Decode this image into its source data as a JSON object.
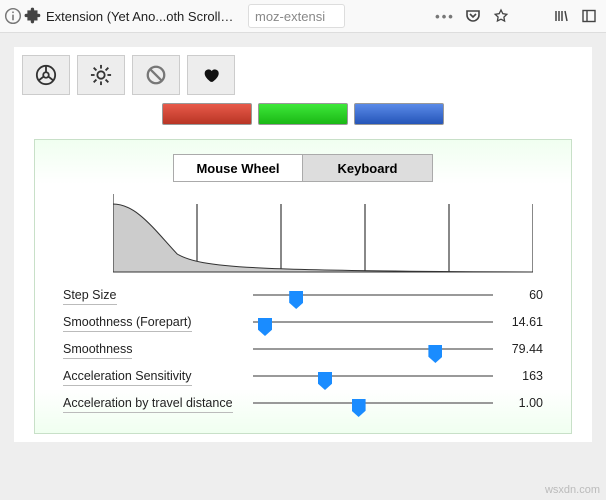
{
  "browser": {
    "tab_title": "Extension (Yet Ano...oth Scrolling WE)",
    "url_text": "moz-extensi"
  },
  "tabs": {
    "mouse_wheel": "Mouse Wheel",
    "keyboard": "Keyboard"
  },
  "sliders": [
    {
      "label": "Step Size",
      "value": "60",
      "pos": 18
    },
    {
      "label": "Smoothness (Forepart)",
      "value": "14.61",
      "pos": 5
    },
    {
      "label": "Smoothness",
      "value": "79.44",
      "pos": 76
    },
    {
      "label": "Acceleration Sensitivity",
      "value": "163",
      "pos": 30
    },
    {
      "label": "Acceleration by travel distance",
      "value": "1.00",
      "pos": 44
    }
  ],
  "chart_data": {
    "type": "area",
    "x": [
      0,
      0.1,
      0.2,
      0.3,
      0.4,
      0.6,
      1.0
    ],
    "values": [
      1.0,
      0.55,
      0.22,
      0.09,
      0.04,
      0.01,
      0.0
    ],
    "ticks": 5,
    "ylim": [
      0,
      1
    ]
  },
  "watermark": "wsxdn.com"
}
